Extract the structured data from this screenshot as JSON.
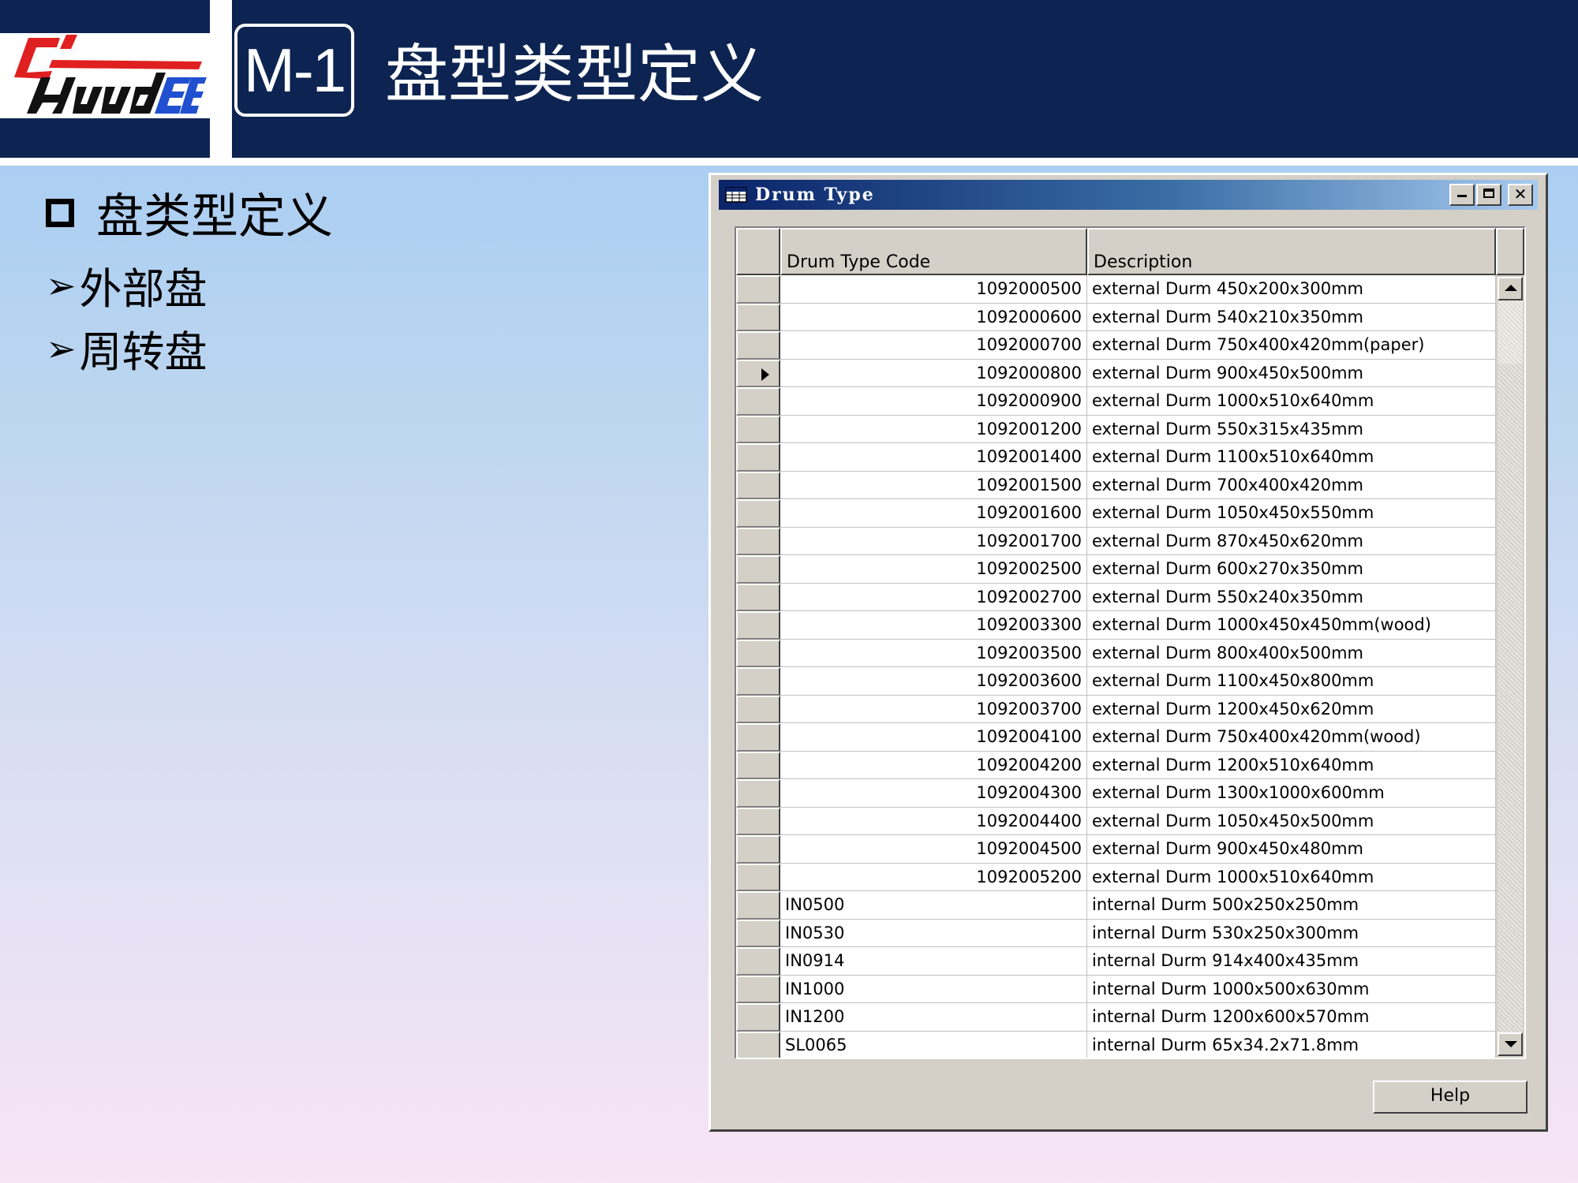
{
  "slide": {
    "logo_text": "ChuudEE",
    "code_label": "M-1",
    "title": "盘型类型定义",
    "main_bullet": "盘类型定义",
    "sub_bullets": [
      "外部盘",
      "周转盘"
    ]
  },
  "window": {
    "title": "Drum Type",
    "icons": [
      "table-icon",
      "minimize-icon",
      "maximize-icon",
      "close-icon"
    ],
    "columns": [
      "Drum Type Code",
      "Description"
    ],
    "selected_row_index": 3,
    "rows": [
      {
        "code": "1092000500",
        "desc": "external Durm 450x200x300mm",
        "numeric": true
      },
      {
        "code": "1092000600",
        "desc": "external Durm 540x210x350mm",
        "numeric": true
      },
      {
        "code": "1092000700",
        "desc": "external Durm 750x400x420mm(paper)",
        "numeric": true
      },
      {
        "code": "1092000800",
        "desc": "external Durm 900x450x500mm",
        "numeric": true
      },
      {
        "code": "1092000900",
        "desc": "external Durm 1000x510x640mm",
        "numeric": true
      },
      {
        "code": "1092001200",
        "desc": "external Durm 550x315x435mm",
        "numeric": true
      },
      {
        "code": "1092001400",
        "desc": "external Durm 1100x510x640mm",
        "numeric": true
      },
      {
        "code": "1092001500",
        "desc": "external Durm 700x400x420mm",
        "numeric": true
      },
      {
        "code": "1092001600",
        "desc": "external Durm 1050x450x550mm",
        "numeric": true
      },
      {
        "code": "1092001700",
        "desc": "external Durm 870x450x620mm",
        "numeric": true
      },
      {
        "code": "1092002500",
        "desc": "external Durm 600x270x350mm",
        "numeric": true
      },
      {
        "code": "1092002700",
        "desc": "external Durm 550x240x350mm",
        "numeric": true
      },
      {
        "code": "1092003300",
        "desc": "external Durm 1000x450x450mm(wood)",
        "numeric": true
      },
      {
        "code": "1092003500",
        "desc": "external Durm 800x400x500mm",
        "numeric": true
      },
      {
        "code": "1092003600",
        "desc": "external Durm 1100x450x800mm",
        "numeric": true
      },
      {
        "code": "1092003700",
        "desc": "external Durm 1200x450x620mm",
        "numeric": true
      },
      {
        "code": "1092004100",
        "desc": "external Durm 750x400x420mm(wood)",
        "numeric": true
      },
      {
        "code": "1092004200",
        "desc": "external Durm 1200x510x640mm",
        "numeric": true
      },
      {
        "code": "1092004300",
        "desc": "external Durm 1300x1000x600mm",
        "numeric": true
      },
      {
        "code": "1092004400",
        "desc": "external Durm 1050x450x500mm",
        "numeric": true
      },
      {
        "code": "1092004500",
        "desc": "external Durm 900x450x480mm",
        "numeric": true
      },
      {
        "code": "1092005200",
        "desc": "external Durm 1000x510x640mm",
        "numeric": true
      },
      {
        "code": "IN0500",
        "desc": "internal Durm 500x250x250mm",
        "numeric": false
      },
      {
        "code": "IN0530",
        "desc": "internal Durm 530x250x300mm",
        "numeric": false
      },
      {
        "code": "IN0914",
        "desc": "internal Durm 914x400x435mm",
        "numeric": false
      },
      {
        "code": "IN1000",
        "desc": "internal Durm 1000x500x630mm",
        "numeric": false
      },
      {
        "code": "IN1200",
        "desc": "internal Durm 1200x600x570mm",
        "numeric": false
      },
      {
        "code": "SL0065",
        "desc": "internal Durm 65x34.2x71.8mm",
        "numeric": false
      }
    ],
    "help_label": "Help"
  },
  "colors": {
    "header_navy": "#0d2452",
    "logo_red": "#e02020",
    "logo_blue": "#2050d0",
    "title_gradient_start": "#0a246a",
    "window_gray": "#d4d0c8"
  }
}
